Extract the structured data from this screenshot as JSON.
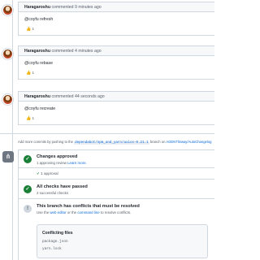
{
  "comments": [
    {
      "author": "Haragaroshu",
      "action": "commented",
      "time": "9 minutes ago",
      "body": "@coyfu refresh",
      "reaction_count": "1"
    },
    {
      "author": "Haragaroshu",
      "action": "commented",
      "time": "4 minutes ago",
      "body": "@coyfu rebase",
      "reaction_count": "1"
    },
    {
      "author": "Haragaroshu",
      "action": "commented",
      "time": "44 seconds ago",
      "body": "@coyfu recreate",
      "reaction_count": "1"
    }
  ],
  "push_note": {
    "prefix": "Add more commits by pushing to the",
    "branch": "dependabot/npm_and_yarn/axios-0.21.1",
    "middle": "branch on",
    "repo": "AGENTlinway/AutoChangelog"
  },
  "merge": {
    "approved_title": "Changes approved",
    "approved_sub_prefix": "1 approving review",
    "approved_sub_link": "Learn more.",
    "approved_row": "1 approval",
    "checks_title": "All checks have passed",
    "checks_sub": "2 successful checks",
    "conflict_title": "This branch has conflicts that must be resolved",
    "conflict_sub_prefix": "Use the",
    "conflict_sub_link1": "web editor",
    "conflict_sub_mid": "or the",
    "conflict_sub_link2": "command line",
    "conflict_sub_suffix": "to resolve conflicts.",
    "files_title": "Conflicting files",
    "files": [
      "package.json",
      "yarn.lock"
    ]
  },
  "colors": {
    "success": "#1a7f37",
    "link": "#0969da",
    "border": "#d0d7de"
  },
  "icons": {
    "merge": "git-merge-icon",
    "check": "check-circle-icon",
    "alert": "alert-icon",
    "thumb": "thumbs-up-icon"
  }
}
